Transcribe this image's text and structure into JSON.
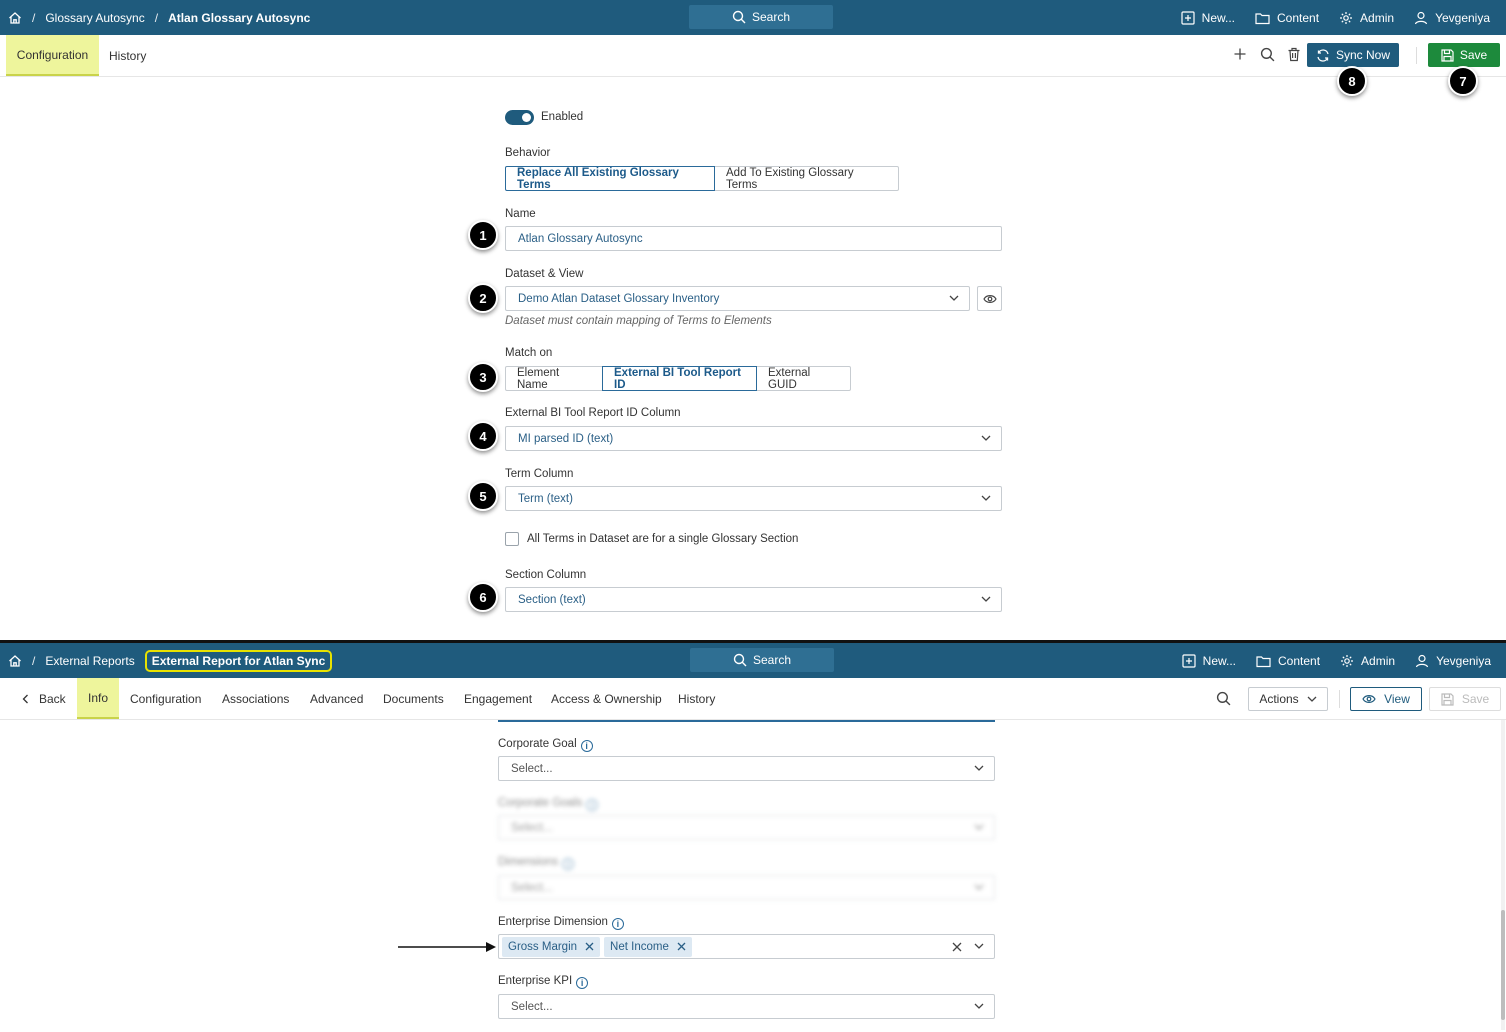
{
  "top": {
    "breadcrumb": [
      "Glossary Autosync",
      "Atlan Glossary Autosync"
    ],
    "search_label": "Search",
    "nav": {
      "new": "New...",
      "content": "Content",
      "admin": "Admin",
      "user": "Yevgeniya"
    },
    "tabs": {
      "configuration": "Configuration",
      "history": "History"
    },
    "sync_now": "Sync Now",
    "save": "Save",
    "enabled_label": "Enabled",
    "behavior": {
      "label": "Behavior",
      "options": [
        "Replace All Existing Glossary Terms",
        "Add To Existing Glossary Terms"
      ],
      "selected": "Replace All Existing Glossary Terms"
    },
    "name": {
      "label": "Name",
      "value": "Atlan Glossary Autosync"
    },
    "dataset": {
      "label": "Dataset & View",
      "value": "Demo Atlan Dataset Glossary Inventory",
      "hint": "Dataset must contain mapping of Terms to Elements"
    },
    "match_on": {
      "label": "Match on",
      "options": [
        "Element Name",
        "External BI Tool Report ID",
        "External GUID"
      ],
      "selected": "External BI Tool Report ID"
    },
    "report_id_column": {
      "label": "External BI Tool Report ID Column",
      "value": "MI parsed ID (text)"
    },
    "term_column": {
      "label": "Term Column",
      "value": "Term (text)"
    },
    "single_section": {
      "label": "All Terms in Dataset are for a single Glossary Section",
      "checked": false
    },
    "section_column": {
      "label": "Section Column",
      "value": "Section (text)"
    },
    "markers": [
      "1",
      "2",
      "3",
      "4",
      "5",
      "6",
      "7",
      "8"
    ]
  },
  "bottom": {
    "breadcrumb": [
      "External Reports",
      "External Report for Atlan Sync"
    ],
    "search_label": "Search",
    "nav": {
      "new": "New...",
      "content": "Content",
      "admin": "Admin",
      "user": "Yevgeniya"
    },
    "tabs": [
      "Back",
      "Info",
      "Configuration",
      "Associations",
      "Advanced",
      "Documents",
      "Engagement",
      "Access & Ownership",
      "History"
    ],
    "active_tab": "Info",
    "actions": "Actions",
    "view": "View",
    "save": "Save",
    "corporate_goal": {
      "label": "Corporate Goal",
      "placeholder": "Select..."
    },
    "corporate_goals": {
      "label": "Corporate Goals",
      "placeholder": "Select..."
    },
    "dimensions": {
      "label": "Dimensions",
      "placeholder": "Select..."
    },
    "enterprise_dimension": {
      "label": "Enterprise Dimension",
      "chips": [
        "Gross Margin",
        "Net Income"
      ]
    },
    "enterprise_kpi": {
      "label": "Enterprise KPI",
      "placeholder": "Select..."
    }
  },
  "colors": {
    "navbar": "#1f5b7d",
    "tab_highlight": "#eef59c",
    "save_green": "#1d8a3c",
    "callout": "#e8e200"
  }
}
